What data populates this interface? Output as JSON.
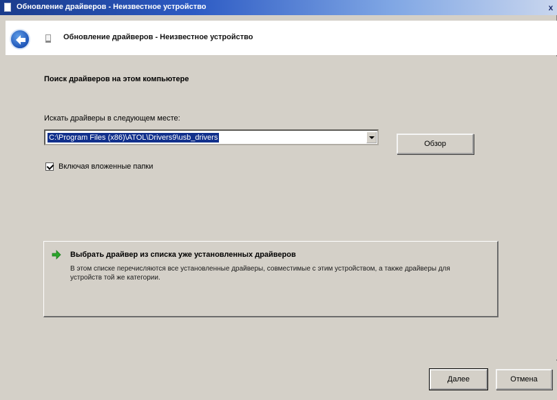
{
  "window": {
    "title": "Обновление драйверов - Неизвестное устройство",
    "close_glyph": "x"
  },
  "header": {
    "title": "Обновление драйверов - Неизвестное устройство",
    "back_icon": "back-arrow-icon",
    "device_icon": "device-icon"
  },
  "main": {
    "section_title": "Поиск драйверов на этом компьютере",
    "search_label": "Искать драйверы в следующем месте:",
    "path_value": "C:\\Program Files (x86)\\ATOL\\Drivers9\\usb_drivers",
    "browse_label": "Обзор",
    "include_subfolders_label": "Включая вложенные папки",
    "include_subfolders_checked": true,
    "pick_link": {
      "title": "Выбрать драйвер из списка уже установленных драйверов",
      "description": "В этом списке перечисляются все установленные драйверы, совместимые с этим устройством, а также драйверы для устройств той же категории.",
      "icon": "green-arrow-icon"
    }
  },
  "footer": {
    "next_label": "Далее",
    "cancel_label": "Отмена"
  },
  "colors": {
    "dialog_bg": "#d4d0c8",
    "titlebar_start": "#1a3c8c",
    "selection": "#11308c",
    "arrow_green": "#2aa62a"
  }
}
